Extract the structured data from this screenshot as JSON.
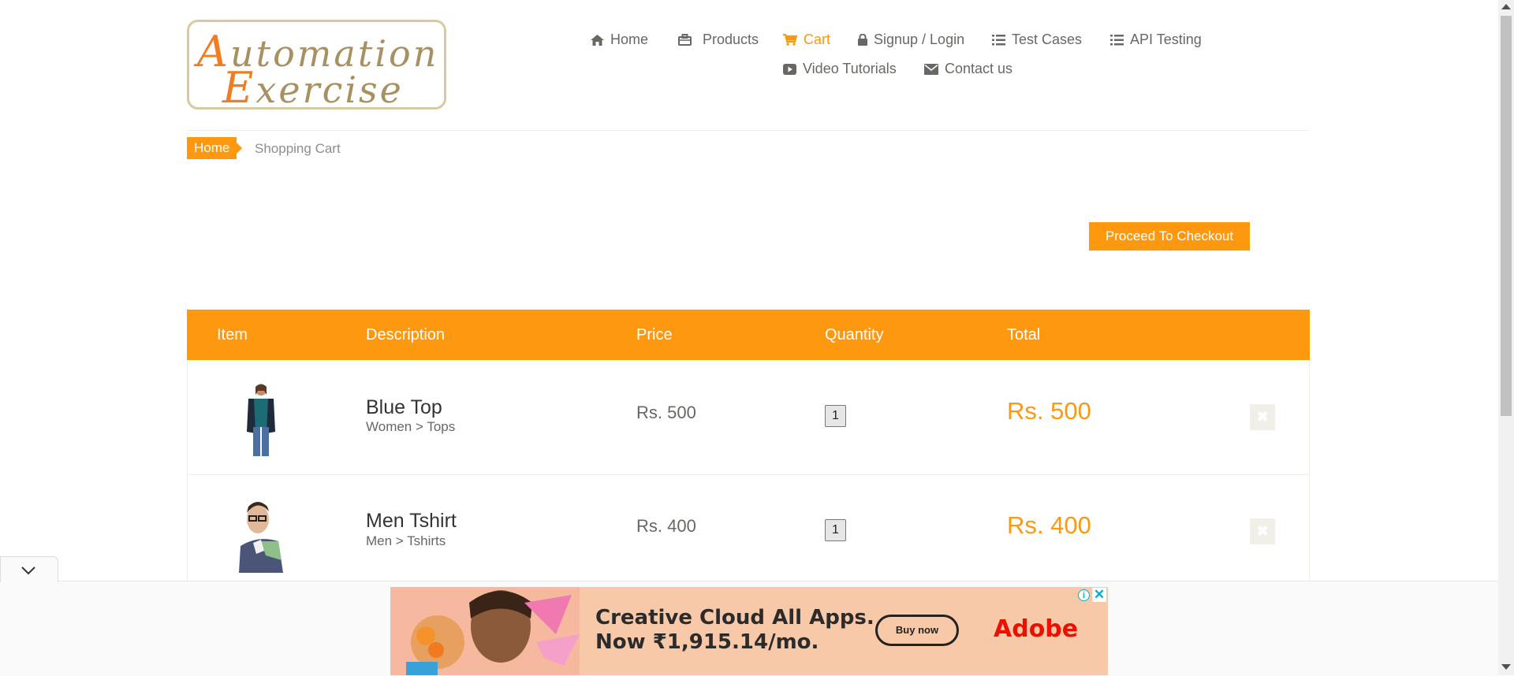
{
  "brand": {
    "line1_cap": "A",
    "line1_rest": "utomation",
    "line2_cap": "E",
    "line2_rest": "xercise"
  },
  "nav": [
    {
      "label": "Home",
      "icon": "home-icon"
    },
    {
      "label": "Products",
      "icon": "briefcase-icon"
    },
    {
      "label": "Cart",
      "icon": "cart-icon",
      "active": true
    },
    {
      "label": "Signup / Login",
      "icon": "lock-icon"
    },
    {
      "label": "Test Cases",
      "icon": "list-icon"
    },
    {
      "label": "API Testing",
      "icon": "list-icon"
    },
    {
      "label": "Video Tutorials",
      "icon": "youtube-icon"
    },
    {
      "label": "Contact us",
      "icon": "envelope-icon"
    }
  ],
  "breadcrumb": {
    "home": "Home",
    "current": "Shopping Cart"
  },
  "checkout_label": "Proceed To Checkout",
  "table": {
    "headers": [
      "Item",
      "Description",
      "Price",
      "Quantity",
      "Total"
    ],
    "rows": [
      {
        "name": "Blue Top",
        "category": "Women > Tops",
        "price": "Rs. 500",
        "quantity": "1",
        "total": "Rs. 500",
        "delete": "✖"
      },
      {
        "name": "Men Tshirt",
        "category": "Men > Tshirts",
        "price": "Rs. 400",
        "quantity": "1",
        "total": "Rs. 400",
        "delete": "✖"
      }
    ]
  },
  "ad": {
    "headline1": "Creative Cloud All Apps.",
    "headline2": "Now ₹1,915.14/mo.",
    "button": "Buy now",
    "brand": "Adobe",
    "info": "i",
    "close": "✕"
  },
  "colors": {
    "accent": "#fe980f",
    "text": "#696763",
    "dark_text": "#363432",
    "ad_bg": "#f8c9a8",
    "adobe_red": "#eb1000"
  }
}
